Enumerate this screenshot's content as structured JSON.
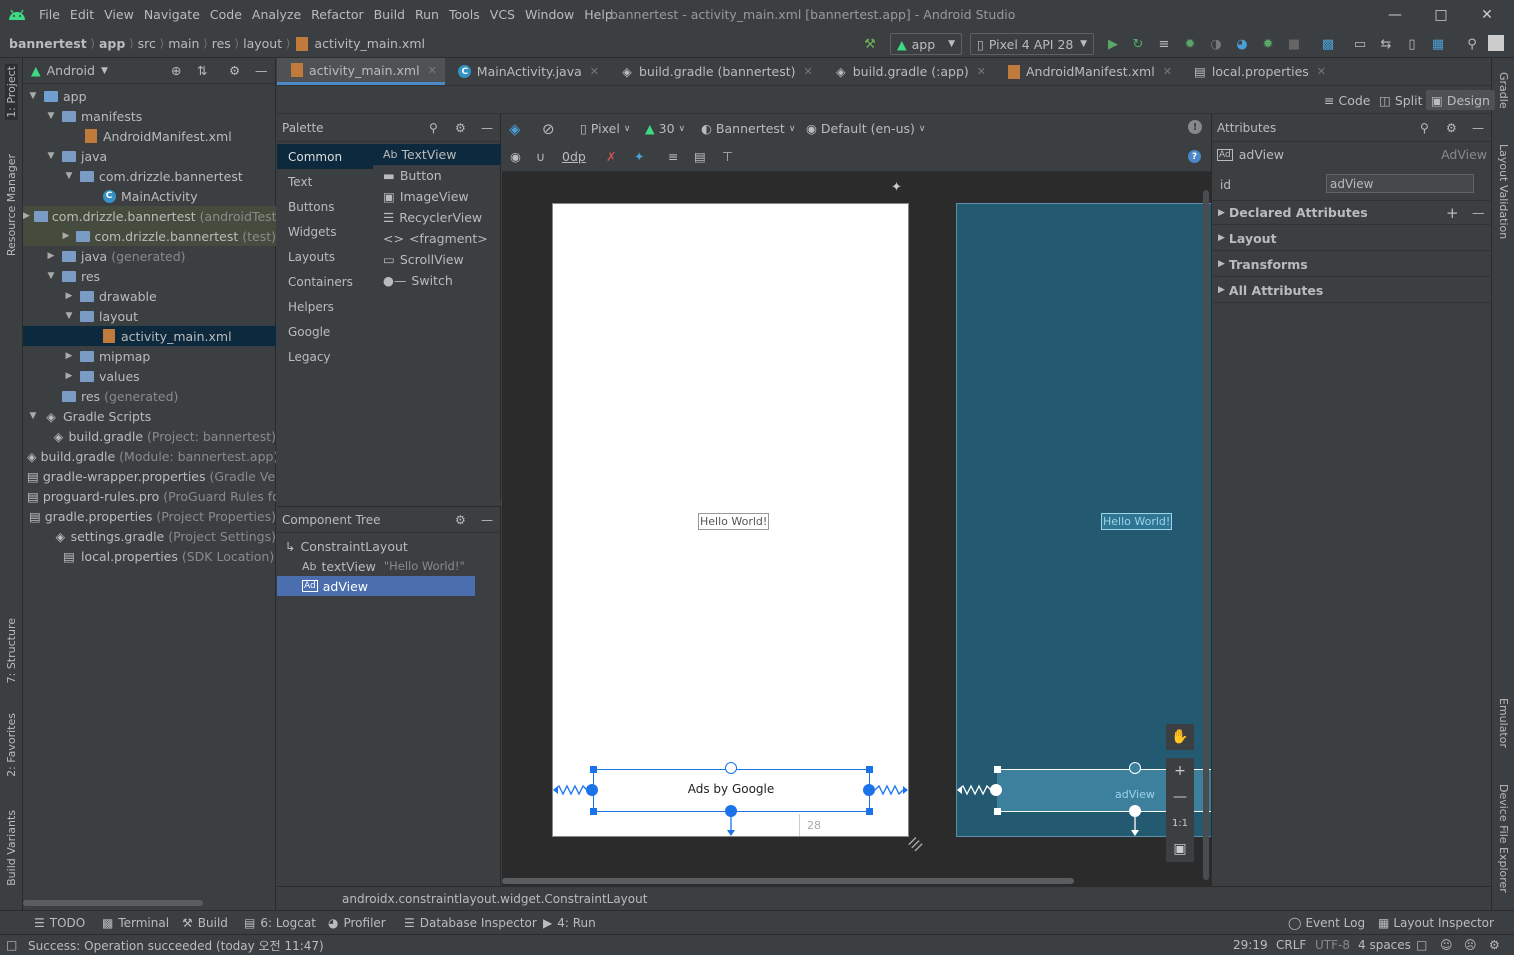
{
  "menu": {
    "items": [
      "File",
      "Edit",
      "View",
      "Navigate",
      "Code",
      "Analyze",
      "Refactor",
      "Build",
      "Run",
      "Tools",
      "VCS",
      "Window",
      "Help"
    ],
    "window_title": "bannertest - activity_main.xml [bannertest.app] - Android Studio"
  },
  "breadcrumb": [
    "bannertest",
    "app",
    "src",
    "main",
    "res",
    "layout",
    "activity_main.xml"
  ],
  "toolbar": {
    "run_config": "app",
    "device": "Pixel 4 API 28"
  },
  "left_tabs": [
    "1: Project",
    "Resource Manager",
    "7: Structure",
    "2: Favorites",
    "Build Variants"
  ],
  "right_tabs": [
    "Gradle",
    "Layout Validation",
    "Emulator",
    "Device File Explorer"
  ],
  "project": {
    "view_mode": "Android",
    "rows": [
      {
        "label": "app",
        "extra": ""
      },
      {
        "label": "manifests",
        "extra": ""
      },
      {
        "label": "AndroidManifest.xml",
        "extra": ""
      },
      {
        "label": "java",
        "extra": ""
      },
      {
        "label": "com.drizzle.bannertest",
        "extra": ""
      },
      {
        "label": "MainActivity",
        "extra": ""
      },
      {
        "label": "com.drizzle.bannertest",
        "extra": "(androidTest)"
      },
      {
        "label": "com.drizzle.bannertest",
        "extra": "(test)"
      },
      {
        "label": "java",
        "extra": "(generated)"
      },
      {
        "label": "res",
        "extra": ""
      },
      {
        "label": "drawable",
        "extra": ""
      },
      {
        "label": "layout",
        "extra": ""
      },
      {
        "label": "activity_main.xml",
        "extra": ""
      },
      {
        "label": "mipmap",
        "extra": ""
      },
      {
        "label": "values",
        "extra": ""
      },
      {
        "label": "res",
        "extra": "(generated)"
      },
      {
        "label": "Gradle Scripts",
        "extra": ""
      },
      {
        "label": "build.gradle",
        "extra": "(Project: bannertest)"
      },
      {
        "label": "build.gradle",
        "extra": "(Module: bannertest.app)"
      },
      {
        "label": "gradle-wrapper.properties",
        "extra": "(Gradle Version)"
      },
      {
        "label": "proguard-rules.pro",
        "extra": "(ProGuard Rules for bannertest.app)"
      },
      {
        "label": "gradle.properties",
        "extra": "(Project Properties)"
      },
      {
        "label": "settings.gradle",
        "extra": "(Project Settings)"
      },
      {
        "label": "local.properties",
        "extra": "(SDK Location)"
      }
    ]
  },
  "editor_tabs": [
    "activity_main.xml",
    "MainActivity.java",
    "build.gradle (bannertest)",
    "build.gradle (:app)",
    "AndroidManifest.xml",
    "local.properties"
  ],
  "modes": [
    "Code",
    "Split",
    "Design"
  ],
  "palette": {
    "title": "Palette",
    "categories": [
      "Common",
      "Text",
      "Buttons",
      "Widgets",
      "Layouts",
      "Containers",
      "Helpers",
      "Google",
      "Legacy"
    ],
    "items": [
      "TextView",
      "Button",
      "ImageView",
      "RecyclerView",
      "<fragment>",
      "ScrollView",
      "Switch"
    ]
  },
  "component_tree": {
    "title": "Component Tree",
    "root": "ConstraintLayout",
    "text_view": {
      "label": "textView",
      "value": "\"Hello World!\""
    },
    "ad_view": "adView"
  },
  "canvas_toolbar": {
    "device": "Pixel",
    "api": "30",
    "theme": "Bannertest",
    "locale": "Default (en-us)",
    "margin": "0dp"
  },
  "canvas": {
    "hello": "Hello World!",
    "ads": "Ads by Google",
    "ad_label": "adView",
    "margin_hint": "28",
    "zoom_fit": "1:1"
  },
  "attributes": {
    "title": "Attributes",
    "widget_name": "adView",
    "widget_type": "AdView",
    "id_label": "id",
    "id_value": "adView",
    "sections": [
      "Declared Attributes",
      "Layout",
      "Transforms",
      "All Attributes"
    ]
  },
  "status_path": "androidx.constraintlayout.widget.ConstraintLayout",
  "tool_windows": [
    "TODO",
    "Terminal",
    "Build",
    "6: Logcat",
    "Profiler",
    "Database Inspector",
    "4: Run"
  ],
  "tool_windows_right": [
    "Event Log",
    "Layout Inspector"
  ],
  "status": {
    "message": "Success: Operation succeeded (today 오전 11:47)",
    "position": "29:19",
    "line_sep": "CRLF",
    "encoding": "UTF-8",
    "indent": "4 spaces"
  }
}
